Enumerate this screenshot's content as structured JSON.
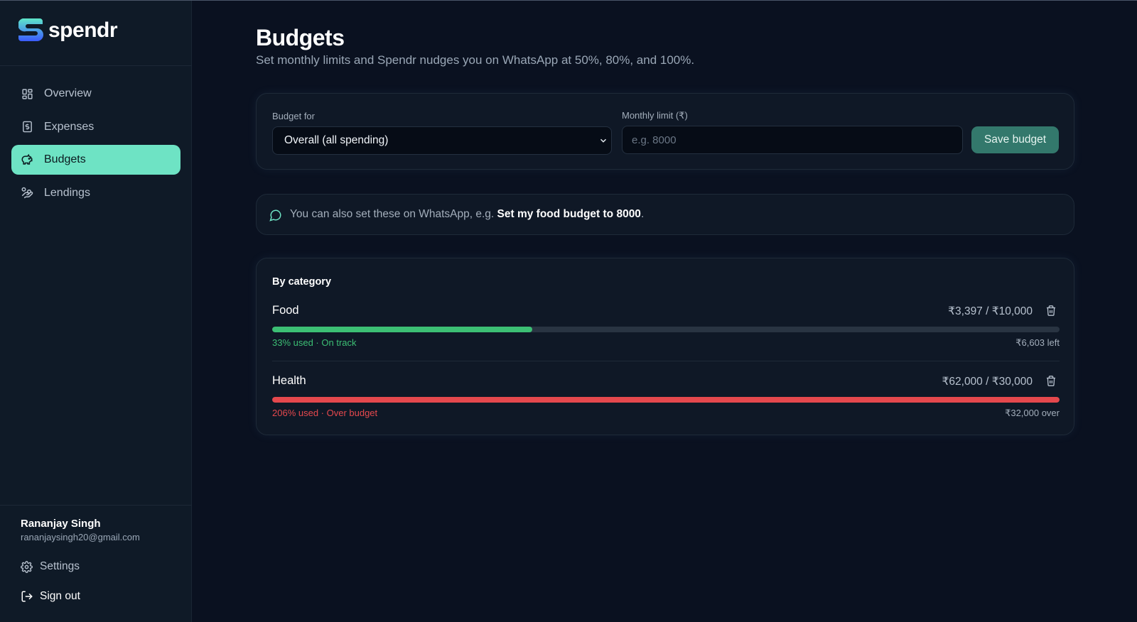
{
  "app": {
    "name": "spendr"
  },
  "sidebar": {
    "items": [
      {
        "label": "Overview",
        "icon": "layout-dashboard-icon",
        "active": false
      },
      {
        "label": "Expenses",
        "icon": "receipt-icon",
        "active": false
      },
      {
        "label": "Budgets",
        "icon": "piggy-bank-icon",
        "active": true
      },
      {
        "label": "Lendings",
        "icon": "hand-coins-icon",
        "active": false
      }
    ],
    "user": {
      "name": "Rananjay Singh",
      "email": "rananjaysingh20@gmail.com"
    },
    "settings_label": "Settings",
    "signout_label": "Sign out"
  },
  "page": {
    "title": "Budgets",
    "subtitle": "Set monthly limits and Spendr nudges you on WhatsApp at 50%, 80%, and 100%."
  },
  "form": {
    "budget_for_label": "Budget for",
    "budget_for_value": "Overall (all spending)",
    "limit_label": "Monthly limit (₹)",
    "limit_placeholder": "e.g. 8000",
    "limit_value": "",
    "save_label": "Save budget"
  },
  "tip": {
    "text": "You can also set these on WhatsApp, e.g. ",
    "example": "Set my food budget to 8000",
    "suffix": "."
  },
  "categories": {
    "title": "By category",
    "rows": [
      {
        "name": "Food",
        "amount": "₹3,397 / ₹10,000",
        "used_fraction": 0.33,
        "status": "33% used · On track",
        "remaining": "₹6,603 left",
        "color": "#3cbf74"
      },
      {
        "name": "Health",
        "amount": "₹62,000 / ₹30,000",
        "used_fraction": 1.0,
        "status": "206% used · Over budget",
        "remaining": "₹32,000 over",
        "color": "#e5484d"
      }
    ]
  },
  "colors": {
    "accent": "#6ee3c4",
    "button": "#33786c",
    "on_track": "#3cbf74",
    "over_budget": "#e5484d",
    "background": "#0a1120"
  }
}
